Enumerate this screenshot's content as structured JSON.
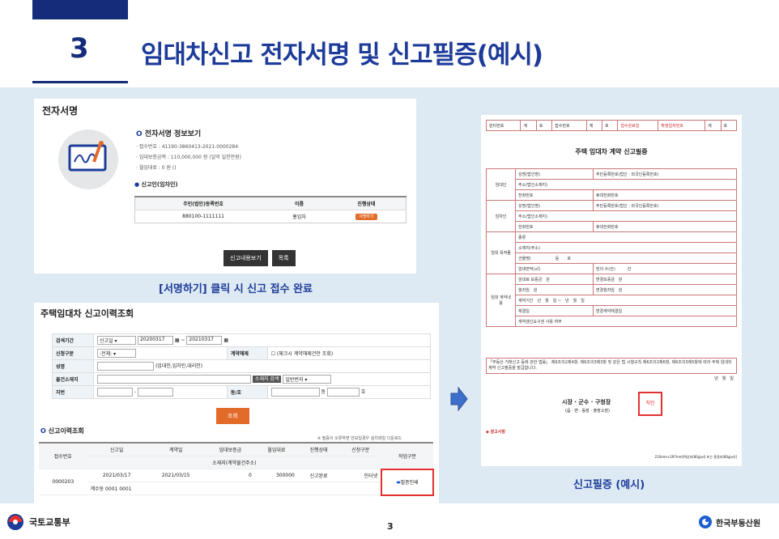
{
  "header": {
    "number": "3",
    "title": "임대차신고 전자서명 및 신고필증(예시)"
  },
  "esign": {
    "heading": "전자서명",
    "info_title": "전자서명 정보보기",
    "receipt": "· 접수번호 : 41190-3860413-2021-0000284",
    "deposit": "· 임대보증금액 : 110,000,000 원 (일억 일천만원)",
    "rent": "· 월임대료 : 0 원 ()",
    "reporter_title": "신고인(임차인)",
    "cols": [
      "주민(법인)등록번호",
      "이름",
      "진행상태"
    ],
    "row": [
      "880100-1111111",
      "홍임차",
      "서명하기"
    ],
    "btn_view": "신고내용보기",
    "btn_list": "목록"
  },
  "caption1": "[서명하기] 클릭 시 신고 접수 완료",
  "history": {
    "heading": "주택임대차 신고이력조회",
    "period_label": "검색기간",
    "period_type": "신고일",
    "date_from": "20200317",
    "date_to": "20210317",
    "tilde": "~",
    "type_label": "신청구분",
    "type_value": ":전체:",
    "cancel_label": "계약해제",
    "cancel_opt": "(체크시 계약해제건만 조회)",
    "name_label": "성명",
    "name_hint": "(임대인,임차인,대리인)",
    "addr_label": "물건소재지",
    "addr_btn": "소재지 검색",
    "addr_opt": "일반번지",
    "lot_label": "지번",
    "dong_label": "동/호",
    "dong_suffix": "동",
    "ho_suffix": "호",
    "search_btn": "조회",
    "list_title": "신고이력조회",
    "notice": "※ 필증이 오류하면 안보일경우 설치파일 다운로드",
    "cols1": [
      "접수번호",
      "신고일",
      "계약일",
      "임대보증금",
      "월임대료",
      "진행상태",
      "신청구분",
      "작업구분"
    ],
    "cols2": "소재지(계약물건주소)",
    "row": {
      "no": "0000203",
      "report": "2021/03/17",
      "contract": "2021/03/15",
      "deposit": "0",
      "rent": "300000",
      "status": "신고완료",
      "kind": "인터넷",
      "addr": "계수동 0001 0001",
      "print": "필증인쇄"
    }
  },
  "cert": {
    "top": [
      "원터번호",
      "계",
      "호",
      "접수번호",
      "계",
      "호",
      "접수완료일",
      "확정일자번호",
      "계",
      "호"
    ],
    "title": "주택 임대차 계약 신고필증",
    "landlord": "임대인",
    "tenant": "임차인",
    "object": "임대 목적물",
    "contract": "임대 계약내용",
    "name": "성명(법인명)",
    "idno": "주민등록번호(법인 · 외국인등록번호)",
    "addr": "주소(법인소재지)",
    "tel": "전화번호",
    "mobile": "휴대전화번호",
    "kind": "종류",
    "loc": "소재지(주소)",
    "bldg": "건물명(",
    "dong": "동",
    "ho": "호",
    "area": "임대면적(㎡)",
    "rooms": "방의 수(칸)",
    "kan": "칸",
    "rentfee": "임대료",
    "dep": "보증금",
    "won": "원",
    "chgdep": "변경보증금",
    "monthly": "월차임",
    "chgmon": "변경월차임",
    "period": "계약기간",
    "periodval": "년　월　일 ~　년　월　일",
    "sign": "체결일",
    "chgsign": "변경계약체결일",
    "renew": "계약갱신요구권 사용 여부",
    "law": "「부동산 거래신고 등에 관한 법률」 제6조의2제4항, 제6조의3제3항 및 같은 법 시행규칙 제6조의2제6항, 제6조의3제5항에 따라 주택 임대차 계약 신고필증을 발급합니다.",
    "date": "년　월　일",
    "mayor": "시장 · 군수 · 구청장",
    "sub": "(읍 · 면 · 동장 · 출장소장)",
    "seal": "직인",
    "note_title": "◆ 참고사항",
    "size": "210mm×297mm[백상지(80g/㎡) 또는 중질지(80g/㎡)]"
  },
  "caption2": "신고필증 (예시)",
  "footer": {
    "ministry": "국토교통부",
    "page": "3",
    "org": "한국부동산원"
  },
  "colors": {
    "navy": "#142c7a",
    "blue": "#1d3c9a",
    "orange": "#e36b2a",
    "red": "#e33030"
  }
}
